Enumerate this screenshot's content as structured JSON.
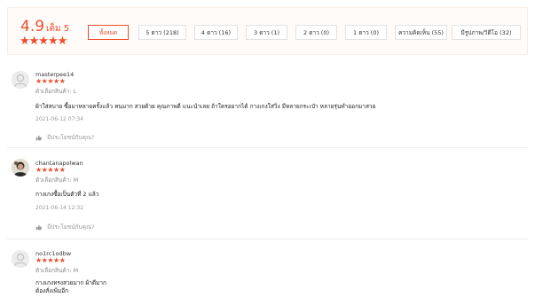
{
  "summary": {
    "score": "4.9",
    "out_of": "เต็ม 5",
    "stars": "★★★★★"
  },
  "filters": [
    "ทั้งหมด",
    "5 ดาว (218)",
    "4 ดาว (16)",
    "3 ดาว (1)",
    "2 ดาว (0)",
    "1 ดาว (0)",
    "ความคิดเห็น (55)",
    "มีรูปภาพ/วิดีโอ (32)"
  ],
  "colors": {
    "accent": "#ee4d2d",
    "background": "#fffbf8"
  },
  "reviews": [
    {
      "username": "masterpee14",
      "stars": "★★★★★",
      "variation": "ตัวเลือกสินค้า: L",
      "comment_lines": [
        "ผ้าใส่สบาย ซื้อมาหลายครั้งแล้ว หนมาก สวยด้วย คุณภาพดี แนะนำเลย ถ้าใครอยากได้ กางเกงใส่วิ่ง มีหลายกระเป๋า หลายรุ่นทำออกมาสวย"
      ],
      "date": "2021-06-12 07:34",
      "helpful": "มีประโยชน์กับคุณ?",
      "avatar": "default-user-avatar"
    },
    {
      "username": "chantanapolwan",
      "stars": "★★★★★",
      "variation": "ตัวเลือกสินค้า: M",
      "comment_lines": [
        "กางเกงซื้อเป็นตัวที่ 2 แล้ว"
      ],
      "date": "2021-06-14 12:32",
      "helpful": "มีประโยชน์กับคุณ?",
      "avatar": "photo-avatar"
    },
    {
      "username": "no1rc1odbw",
      "stars": "★★★★★",
      "variation": "ตัวเลือกสินค้า: M",
      "comment_lines": [
        "กางเกงทรงสวยมาก ผ้าดีมาก",
        "ต้องสั่งเพิ่มอีก"
      ],
      "avatar": "default-user-avatar"
    }
  ]
}
